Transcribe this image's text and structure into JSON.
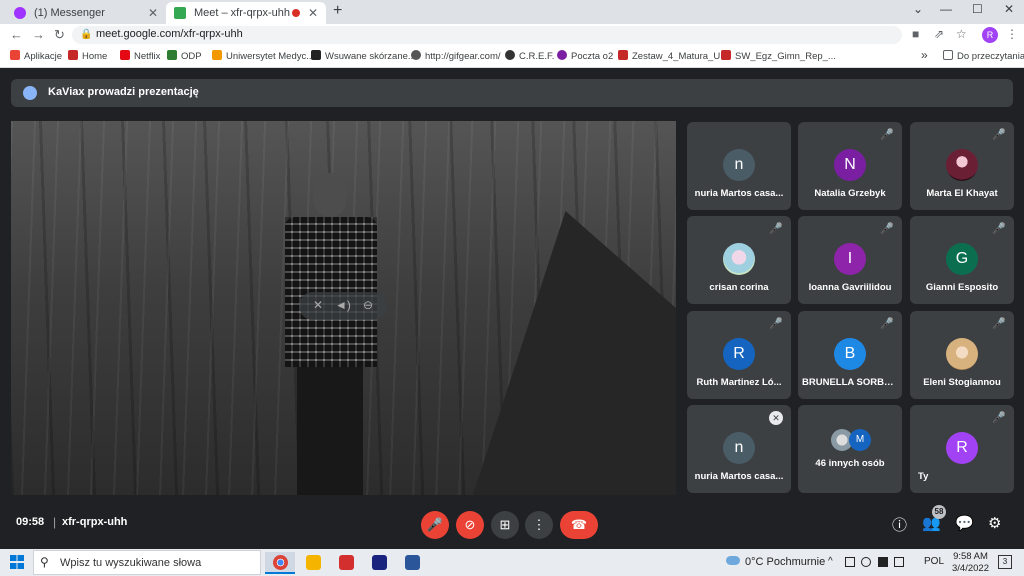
{
  "browser": {
    "tabs": [
      {
        "title": "(1) Messenger",
        "close": "✕",
        "favicon_color": "#a033ff"
      },
      {
        "title": "Meet – xfr-qrpx-uhh",
        "close": "✕",
        "favicon_color": "#34a853",
        "recording_dot": true
      }
    ],
    "new_tab_glyph": "+",
    "window_controls": {
      "chevron": "⌄",
      "minimize": "—",
      "maximize": "☐",
      "close": "✕"
    },
    "nav": {
      "back": "←",
      "forward": "→",
      "reload": "↻"
    },
    "url": "meet.google.com/xfr-qrpx-uhh",
    "address_icons": {
      "lock": "🔒",
      "camera": "■",
      "share": "⇗",
      "star": "☆",
      "menu": "⋮"
    },
    "profile_letter": "R",
    "bookmarks": [
      {
        "label": "Aplikacje",
        "color": "#ea4335"
      },
      {
        "label": "Home",
        "color": "#c62828"
      },
      {
        "label": "Netflix",
        "color": "#e50914"
      },
      {
        "label": "ODP",
        "color": "#2e7d32"
      },
      {
        "label": "Uniwersytet Medyc...",
        "color": "#f29900"
      },
      {
        "label": "Wsuwane skórzane...",
        "color": "#222222"
      },
      {
        "label": "http://gifgear.com/",
        "color": "#555555"
      },
      {
        "label": "C.R.E.F.",
        "color": "#333333"
      },
      {
        "label": "Poczta o2",
        "color": "#7b1fa2"
      },
      {
        "label": "Zestaw_4_Matura_U...",
        "color": "#c62828"
      },
      {
        "label": "SW_Egz_Gimn_Rep_...",
        "color": "#c62828"
      }
    ],
    "bookmarks_more": "»",
    "reading_list": "Do przeczytania"
  },
  "meet": {
    "presenting_banner": "KaViax prowadzi prezentację",
    "participants": [
      {
        "name": "nuria Martos casa...",
        "letter": "n",
        "avatar_color": "#4a5c66",
        "muted": false
      },
      {
        "name": "Natalia Grzebyk",
        "letter": "N",
        "avatar_color": "#7b1fa2",
        "muted": true
      },
      {
        "name": "Marta El Khayat",
        "letter": "",
        "avatar_color": "#5a1f2e",
        "photo": true,
        "muted": true
      },
      {
        "name": "crisan corina",
        "letter": "",
        "avatar_color": "#8fb8c9",
        "photo": true,
        "muted": true
      },
      {
        "name": "Ioanna Gavriilidou",
        "letter": "I",
        "avatar_color": "#8e24aa",
        "muted": true
      },
      {
        "name": "Gianni Esposito",
        "letter": "G",
        "avatar_color": "#0b6e4f",
        "muted": true
      },
      {
        "name": "Ruth Martinez Ló...",
        "letter": "R",
        "avatar_color": "#1565c0",
        "muted": true
      },
      {
        "name": "BRUNELLA SORBE...",
        "letter": "B",
        "avatar_color": "#1e88e5",
        "muted": true
      },
      {
        "name": "Eleni Stogiannou",
        "letter": "",
        "avatar_color": "#c9a77a",
        "photo": true,
        "muted": true
      },
      {
        "name": "nuria Martos casa...",
        "letter": "n",
        "avatar_color": "#4a5c66",
        "muted": true,
        "mute_style": "boxed"
      },
      {
        "name": "46 innych osób",
        "letter": "M",
        "avatar_color": "#1565c0",
        "group": true
      },
      {
        "name": "Ty",
        "letter": "R",
        "avatar_color": "#a142f4",
        "muted": true
      }
    ],
    "time": "09:58",
    "separator": "|",
    "meeting_code": "xfr-qrpx-uhh",
    "people_count": "58",
    "icons": {
      "mic_off": "🎤",
      "mute_glyph": "✕",
      "cam_off": "⊘",
      "present": "⊞",
      "more": "⋮",
      "hangup": "☎",
      "info": "ⓘ",
      "people": "👥",
      "chat": "💬",
      "activities": "⚙",
      "vol_mute": "✕",
      "vol_speaker": "◄)",
      "vol_minus": "⊖"
    }
  },
  "taskbar": {
    "search_placeholder": "Wpisz tu wyszukiwane słowa",
    "search_glyph": "⚲",
    "apps": [
      {
        "name": "chrome",
        "color": "#db4437",
        "active": true
      },
      {
        "name": "file-explorer",
        "color": "#f4b400"
      },
      {
        "name": "acrobat",
        "color": "#d32f2f"
      },
      {
        "name": "app-w-dark",
        "color": "#1a237e"
      },
      {
        "name": "word",
        "color": "#2b579a"
      }
    ],
    "weather": "0°C Pochmurnie",
    "tray": {
      "up": "^",
      "language": "POL"
    },
    "time": "9:58 AM",
    "date": "3/4/2022",
    "notification_count": "3"
  }
}
